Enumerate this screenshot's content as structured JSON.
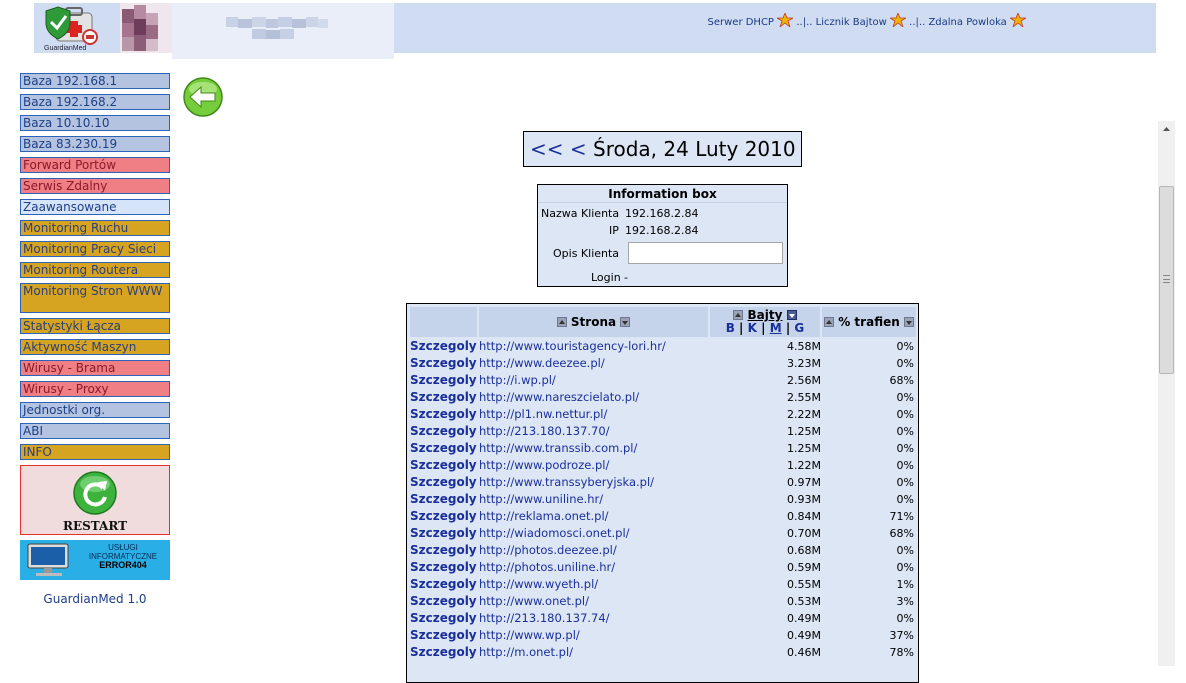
{
  "header": {
    "logo_text": "GuardianMed",
    "links": [
      {
        "label": "Serwer DHCP"
      },
      {
        "label": "Licznik Bajtow"
      },
      {
        "label": "Zdalna Powloka"
      }
    ],
    "separator": "..|.."
  },
  "sidebar": {
    "items": [
      {
        "label": "Baza 192.168.1",
        "style": "blue"
      },
      {
        "label": "Baza 192.168.2",
        "style": "blue"
      },
      {
        "label": "Baza 10.10.10",
        "style": "blue"
      },
      {
        "label": "Baza 83.230.19",
        "style": "blue"
      },
      {
        "label": "Forward Portów",
        "style": "red"
      },
      {
        "label": "Serwis Zdalny",
        "style": "red"
      },
      {
        "label": "Zaawansowane",
        "style": "light"
      },
      {
        "label": "Monitoring Ruchu",
        "style": "gold"
      },
      {
        "label": "Monitoring Pracy Sieci",
        "style": "gold"
      },
      {
        "label": "Monitoring Routera",
        "style": "gold"
      },
      {
        "label": "Monitoring Stron WWW",
        "style": "gold tall"
      },
      {
        "label": "Statystyki Łącza",
        "style": "gold"
      },
      {
        "label": "Aktywność Maszyn",
        "style": "gold"
      },
      {
        "label": "Wirusy - Brama",
        "style": "red"
      },
      {
        "label": "Wirusy - Proxy",
        "style": "red"
      },
      {
        "label": "Jednostki org.",
        "style": "blue"
      },
      {
        "label": "ABI",
        "style": "blue"
      },
      {
        "label": "INFO",
        "style": "gold"
      }
    ],
    "restart_label": "RESTART",
    "banner": {
      "line1": "USŁUGI",
      "line2": "INFORMATYCZNE",
      "line3": "ERROR404"
    },
    "version": "GuardianMed 1.0"
  },
  "date_nav": {
    "prev_prev": "<<",
    "prev": "<",
    "date": "Środa, 24 Luty 2010"
  },
  "info_box": {
    "title": "Information box",
    "client_name_label": "Nazwa Klienta",
    "client_name": "192.168.2.84",
    "ip_label": "IP",
    "ip": "192.168.2.84",
    "desc_label": "Opis Klienta",
    "desc_value": "",
    "login_label": "Login",
    "login_value": "-"
  },
  "table": {
    "col_site": "Strona",
    "col_bytes": "Bajty",
    "col_hits": "% trafien",
    "units": [
      "B",
      "K",
      "M",
      "G"
    ],
    "unit_sep": "|",
    "rows": [
      {
        "detail": "Szczegoly",
        "url": "http://www.touristagency-lori.hr/",
        "bytes": "4.58M",
        "pct": "0%"
      },
      {
        "detail": "Szczegoly",
        "url": "http://www.deezee.pl/",
        "bytes": "3.23M",
        "pct": "0%"
      },
      {
        "detail": "Szczegoly",
        "url": "http://i.wp.pl/",
        "bytes": "2.56M",
        "pct": "68%"
      },
      {
        "detail": "Szczegoly",
        "url": "http://www.nareszcielato.pl/",
        "bytes": "2.55M",
        "pct": "0%"
      },
      {
        "detail": "Szczegoly",
        "url": "http://pl1.nw.nettur.pl/",
        "bytes": "2.22M",
        "pct": "0%"
      },
      {
        "detail": "Szczegoly",
        "url": "http://213.180.137.70/",
        "bytes": "1.25M",
        "pct": "0%"
      },
      {
        "detail": "Szczegoly",
        "url": "http://www.transsib.com.pl/",
        "bytes": "1.25M",
        "pct": "0%"
      },
      {
        "detail": "Szczegoly",
        "url": "http://www.podroze.pl/",
        "bytes": "1.22M",
        "pct": "0%"
      },
      {
        "detail": "Szczegoly",
        "url": "http://www.transsyberyjska.pl/",
        "bytes": "0.97M",
        "pct": "0%"
      },
      {
        "detail": "Szczegoly",
        "url": "http://www.uniline.hr/",
        "bytes": "0.93M",
        "pct": "0%"
      },
      {
        "detail": "Szczegoly",
        "url": "http://reklama.onet.pl/",
        "bytes": "0.84M",
        "pct": "71%"
      },
      {
        "detail": "Szczegoly",
        "url": "http://wiadomosci.onet.pl/",
        "bytes": "0.70M",
        "pct": "68%"
      },
      {
        "detail": "Szczegoly",
        "url": "http://photos.deezee.pl/",
        "bytes": "0.68M",
        "pct": "0%"
      },
      {
        "detail": "Szczegoly",
        "url": "http://photos.uniline.hr/",
        "bytes": "0.59M",
        "pct": "0%"
      },
      {
        "detail": "Szczegoly",
        "url": "http://www.wyeth.pl/",
        "bytes": "0.55M",
        "pct": "1%"
      },
      {
        "detail": "Szczegoly",
        "url": "http://www.onet.pl/",
        "bytes": "0.53M",
        "pct": "3%"
      },
      {
        "detail": "Szczegoly",
        "url": "http://213.180.137.74/",
        "bytes": "0.49M",
        "pct": "0%"
      },
      {
        "detail": "Szczegoly",
        "url": "http://www.wp.pl/",
        "bytes": "0.49M",
        "pct": "37%"
      },
      {
        "detail": "Szczegoly",
        "url": "http://m.onet.pl/",
        "bytes": "0.46M",
        "pct": "78%"
      }
    ]
  }
}
